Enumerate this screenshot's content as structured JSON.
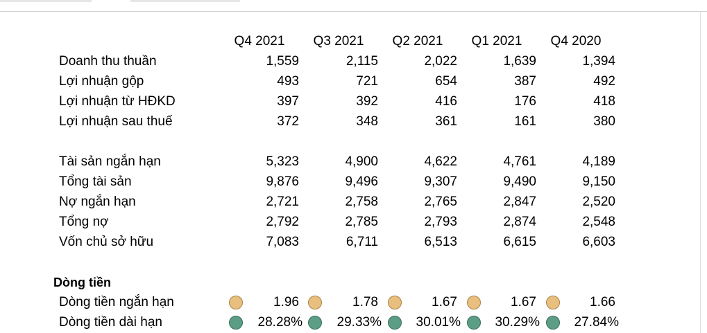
{
  "columns": [
    "Q4 2021",
    "Q3 2021",
    "Q2 2021",
    "Q1 2021",
    "Q4 2020"
  ],
  "income_rows": [
    {
      "label": "Doanh thu thuần",
      "values": [
        "1,559",
        "2,115",
        "2,022",
        "1,639",
        "1,394"
      ]
    },
    {
      "label": "Lợi nhuận gộp",
      "values": [
        "493",
        "721",
        "654",
        "387",
        "492"
      ]
    },
    {
      "label": "Lợi nhuận từ HĐKD",
      "values": [
        "397",
        "392",
        "416",
        "176",
        "418"
      ]
    },
    {
      "label": "Lợi nhuận sau thuế",
      "values": [
        "372",
        "348",
        "361",
        "161",
        "380"
      ]
    }
  ],
  "balance_rows": [
    {
      "label": "Tài sản ngắn hạn",
      "values": [
        "5,323",
        "4,900",
        "4,622",
        "4,761",
        "4,189"
      ]
    },
    {
      "label": "Tổng tài sản",
      "values": [
        "9,876",
        "9,496",
        "9,307",
        "9,490",
        "9,150"
      ]
    },
    {
      "label": "Nợ ngắn hạn",
      "values": [
        "2,721",
        "2,758",
        "2,765",
        "2,847",
        "2,520"
      ]
    },
    {
      "label": "Tổng nợ",
      "values": [
        "2,792",
        "2,785",
        "2,793",
        "2,874",
        "2,548"
      ]
    },
    {
      "label": "Vốn chủ sở hữu",
      "values": [
        "7,083",
        "6,711",
        "6,513",
        "6,615",
        "6,603"
      ]
    }
  ],
  "cashflow": {
    "title": "Dòng tiền",
    "rows": [
      {
        "label": "Dòng tiền ngắn hạn",
        "values": [
          "1.96",
          "1.78",
          "1.67",
          "1.67",
          "1.66"
        ],
        "indicator": "gold-circle-icon",
        "indicator_color": "#e8bf7e"
      },
      {
        "label": "Dòng tiền dài hạn",
        "values": [
          "28.28%",
          "29.33%",
          "30.01%",
          "30.29%",
          "27.84%"
        ],
        "indicator": "green-circle-icon",
        "indicator_color": "#5c9d86"
      }
    ]
  }
}
